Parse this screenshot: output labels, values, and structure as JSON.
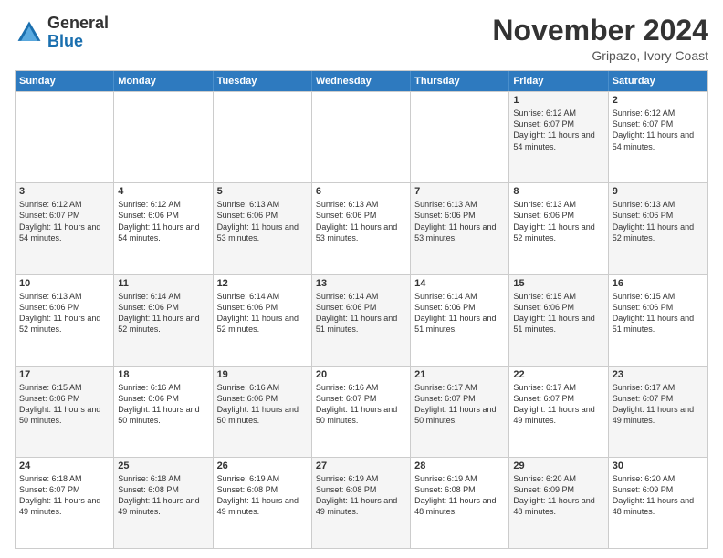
{
  "logo": {
    "general": "General",
    "blue": "Blue"
  },
  "title": {
    "month": "November 2024",
    "location": "Gripazo, Ivory Coast"
  },
  "calendar": {
    "headers": [
      "Sunday",
      "Monday",
      "Tuesday",
      "Wednesday",
      "Thursday",
      "Friday",
      "Saturday"
    ],
    "rows": [
      [
        {
          "day": "",
          "info": "",
          "empty": true
        },
        {
          "day": "",
          "info": "",
          "empty": true
        },
        {
          "day": "",
          "info": "",
          "empty": true
        },
        {
          "day": "",
          "info": "",
          "empty": true
        },
        {
          "day": "",
          "info": "",
          "empty": true
        },
        {
          "day": "1",
          "info": "Sunrise: 6:12 AM\nSunset: 6:07 PM\nDaylight: 11 hours and 54 minutes.",
          "shaded": true
        },
        {
          "day": "2",
          "info": "Sunrise: 6:12 AM\nSunset: 6:07 PM\nDaylight: 11 hours and 54 minutes.",
          "shaded": false
        }
      ],
      [
        {
          "day": "3",
          "info": "Sunrise: 6:12 AM\nSunset: 6:07 PM\nDaylight: 11 hours and 54 minutes.",
          "shaded": true
        },
        {
          "day": "4",
          "info": "Sunrise: 6:12 AM\nSunset: 6:06 PM\nDaylight: 11 hours and 54 minutes.",
          "shaded": false
        },
        {
          "day": "5",
          "info": "Sunrise: 6:13 AM\nSunset: 6:06 PM\nDaylight: 11 hours and 53 minutes.",
          "shaded": true
        },
        {
          "day": "6",
          "info": "Sunrise: 6:13 AM\nSunset: 6:06 PM\nDaylight: 11 hours and 53 minutes.",
          "shaded": false
        },
        {
          "day": "7",
          "info": "Sunrise: 6:13 AM\nSunset: 6:06 PM\nDaylight: 11 hours and 53 minutes.",
          "shaded": true
        },
        {
          "day": "8",
          "info": "Sunrise: 6:13 AM\nSunset: 6:06 PM\nDaylight: 11 hours and 52 minutes.",
          "shaded": false
        },
        {
          "day": "9",
          "info": "Sunrise: 6:13 AM\nSunset: 6:06 PM\nDaylight: 11 hours and 52 minutes.",
          "shaded": true
        }
      ],
      [
        {
          "day": "10",
          "info": "Sunrise: 6:13 AM\nSunset: 6:06 PM\nDaylight: 11 hours and 52 minutes.",
          "shaded": false
        },
        {
          "day": "11",
          "info": "Sunrise: 6:14 AM\nSunset: 6:06 PM\nDaylight: 11 hours and 52 minutes.",
          "shaded": true
        },
        {
          "day": "12",
          "info": "Sunrise: 6:14 AM\nSunset: 6:06 PM\nDaylight: 11 hours and 52 minutes.",
          "shaded": false
        },
        {
          "day": "13",
          "info": "Sunrise: 6:14 AM\nSunset: 6:06 PM\nDaylight: 11 hours and 51 minutes.",
          "shaded": true
        },
        {
          "day": "14",
          "info": "Sunrise: 6:14 AM\nSunset: 6:06 PM\nDaylight: 11 hours and 51 minutes.",
          "shaded": false
        },
        {
          "day": "15",
          "info": "Sunrise: 6:15 AM\nSunset: 6:06 PM\nDaylight: 11 hours and 51 minutes.",
          "shaded": true
        },
        {
          "day": "16",
          "info": "Sunrise: 6:15 AM\nSunset: 6:06 PM\nDaylight: 11 hours and 51 minutes.",
          "shaded": false
        }
      ],
      [
        {
          "day": "17",
          "info": "Sunrise: 6:15 AM\nSunset: 6:06 PM\nDaylight: 11 hours and 50 minutes.",
          "shaded": true
        },
        {
          "day": "18",
          "info": "Sunrise: 6:16 AM\nSunset: 6:06 PM\nDaylight: 11 hours and 50 minutes.",
          "shaded": false
        },
        {
          "day": "19",
          "info": "Sunrise: 6:16 AM\nSunset: 6:06 PM\nDaylight: 11 hours and 50 minutes.",
          "shaded": true
        },
        {
          "day": "20",
          "info": "Sunrise: 6:16 AM\nSunset: 6:07 PM\nDaylight: 11 hours and 50 minutes.",
          "shaded": false
        },
        {
          "day": "21",
          "info": "Sunrise: 6:17 AM\nSunset: 6:07 PM\nDaylight: 11 hours and 50 minutes.",
          "shaded": true
        },
        {
          "day": "22",
          "info": "Sunrise: 6:17 AM\nSunset: 6:07 PM\nDaylight: 11 hours and 49 minutes.",
          "shaded": false
        },
        {
          "day": "23",
          "info": "Sunrise: 6:17 AM\nSunset: 6:07 PM\nDaylight: 11 hours and 49 minutes.",
          "shaded": true
        }
      ],
      [
        {
          "day": "24",
          "info": "Sunrise: 6:18 AM\nSunset: 6:07 PM\nDaylight: 11 hours and 49 minutes.",
          "shaded": false
        },
        {
          "day": "25",
          "info": "Sunrise: 6:18 AM\nSunset: 6:08 PM\nDaylight: 11 hours and 49 minutes.",
          "shaded": true
        },
        {
          "day": "26",
          "info": "Sunrise: 6:19 AM\nSunset: 6:08 PM\nDaylight: 11 hours and 49 minutes.",
          "shaded": false
        },
        {
          "day": "27",
          "info": "Sunrise: 6:19 AM\nSunset: 6:08 PM\nDaylight: 11 hours and 49 minutes.",
          "shaded": true
        },
        {
          "day": "28",
          "info": "Sunrise: 6:19 AM\nSunset: 6:08 PM\nDaylight: 11 hours and 48 minutes.",
          "shaded": false
        },
        {
          "day": "29",
          "info": "Sunrise: 6:20 AM\nSunset: 6:09 PM\nDaylight: 11 hours and 48 minutes.",
          "shaded": true
        },
        {
          "day": "30",
          "info": "Sunrise: 6:20 AM\nSunset: 6:09 PM\nDaylight: 11 hours and 48 minutes.",
          "shaded": false
        }
      ]
    ]
  }
}
